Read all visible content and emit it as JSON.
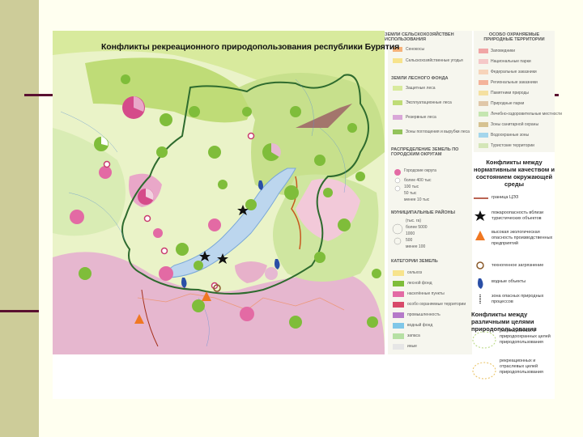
{
  "slide": {
    "accent_sidebar_color": "#cdcc99",
    "rule_color": "#5a1030"
  },
  "map": {
    "title": "Конфликты рекреационного природопользования  республики Бурятия",
    "legend_left": {
      "agri_header": "ЗЕМЛИ СЕЛЬСКОХОЗЯЙСТВЕН ИСПОЛЬЗОВАНИЯ",
      "agri_items": [
        "Сенокосы",
        "Сельскохозяйственные угодья"
      ],
      "forest_header": "ЗЕМЛИ ЛЕСНОГО ФОНДА",
      "forest_items": [
        "Защитные леса",
        "Эксплуатационные леса",
        "Резервные леса",
        "Зоны поглощения и вырубки леса"
      ],
      "distribution_header": "РАСПРЕДЕЛЕНИЕ ЗЕМЕЛЬ ПО ГОРОДСКИМ ОКРУГАМ",
      "distribution_items": [
        "Городские округа",
        "более 400 тыс",
        "100 тыс",
        "50 тыс",
        "менее 10 тыс"
      ],
      "municipal_header": "МУНИЦИПАЛЬНЫЕ РАЙОНЫ",
      "municipal_items": [
        "(тыс. га)",
        "более 5000",
        "1000",
        "500",
        "менее 100"
      ],
      "categories_header": "КАТЕГОРИИ ЗЕМЕЛЬ",
      "categories_items": [
        "сельхоз",
        "лесной фонд",
        "населённые пункты",
        "особо охраняемые территории",
        "промышленность",
        "водный фонд",
        "запаса",
        "иные"
      ]
    },
    "legend_mid": {
      "protected_header": "ОСОБО ОХРАНЯЕМЫЕ ПРИРОДНЫЕ ТЕРРИТОРИИ",
      "protected_items": [
        "Заповедники",
        "Национальные парки",
        "Федеральные заказники",
        "Региональные заказники",
        "Памятники природы",
        "Природные парки",
        "Лечебно-оздоровительные местности",
        "Зоны санитарной охраны",
        "Водоохранные зоны",
        "Туристские территории"
      ]
    },
    "legend_right": {
      "conflicts_quality_title": "Конфликты между нормативным качеством и состоянием окружающей среды",
      "conflict_items": [
        "граница ЦЭЗ",
        "пожароопасность вблизи туристических объектов",
        "высокая экологическая опасность производственных предприятий",
        "техногенное загрязнение",
        "водные объекты",
        "зона опасных природных процессов"
      ],
      "conflicts_goals_title": "Конфликты между различными целями природопользования",
      "goal_items": [
        "рекреационных и природоохранных целей природопользования",
        "рекреационных и отраслевых целей природопользования"
      ]
    }
  }
}
